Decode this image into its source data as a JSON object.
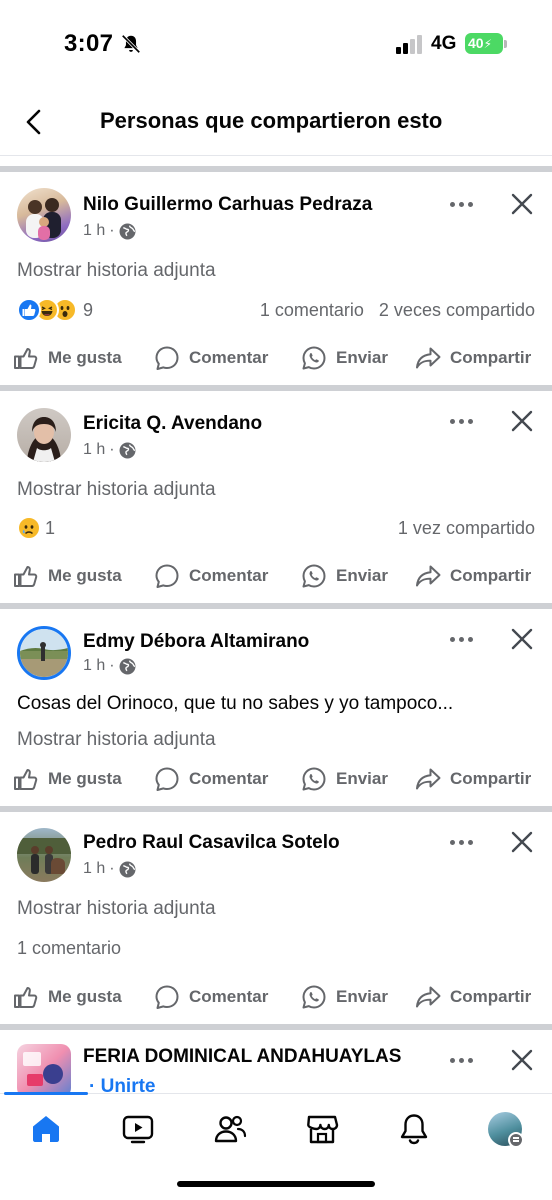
{
  "status_bar": {
    "time": "3:07",
    "network": "4G",
    "battery": "40"
  },
  "header": {
    "title": "Personas que compartieron esto"
  },
  "posts": [
    {
      "author": "Nilo Guillermo Carhuas Pedraza",
      "time": "1 h",
      "story_link": "Mostrar historia adjunta",
      "reaction_count": "9",
      "comments": "1 comentario",
      "shares": "2 veces compartido"
    },
    {
      "author": "Ericita Q. Avendano",
      "time": "1 h",
      "story_link": "Mostrar historia adjunta",
      "reaction_count": "1",
      "shares": "1 vez compartido"
    },
    {
      "author": "Edmy Débora Altamirano",
      "time": "1 h",
      "text": "Cosas del Orinoco, que tu no sabes y yo tampoco...",
      "story_link": "Mostrar historia adjunta"
    },
    {
      "author": "Pedro Raul Casavilca Sotelo",
      "time": "1 h",
      "story_link": "Mostrar historia adjunta",
      "comments": "1 comentario"
    },
    {
      "author": "FERIA DOMINICAL ANDAHUAYLAS",
      "join": "· Unirte"
    }
  ],
  "actions": {
    "like": "Me gusta",
    "comment": "Comentar",
    "send": "Enviar",
    "share": "Compartir"
  },
  "separator": "·",
  "colors": {
    "accent": "#1877f2",
    "muted": "#65676b",
    "separator": "#ced0d4",
    "battery": "#4cd964"
  },
  "icons": [
    "back-arrow-icon",
    "globe-icon",
    "more-icon",
    "close-icon",
    "like-icon",
    "comment-icon",
    "whatsapp-icon",
    "share-icon",
    "home-icon",
    "video-icon",
    "friends-icon",
    "marketplace-icon",
    "bell-icon",
    "profile-avatar"
  ]
}
